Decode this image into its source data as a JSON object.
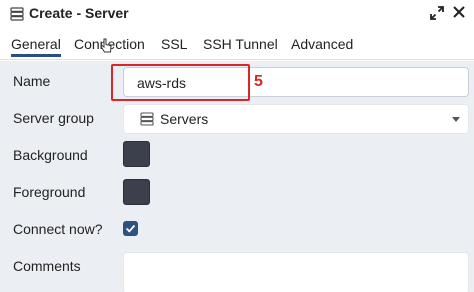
{
  "window": {
    "title": "Create - Server",
    "title_icon": "server-icon",
    "expand_icon": "expand-icon",
    "close_icon": "close-icon",
    "close_glyph": "✕"
  },
  "tabs": [
    {
      "label": "General",
      "active": true
    },
    {
      "label": "Connection",
      "active": false
    },
    {
      "label": "SSL",
      "active": false
    },
    {
      "label": "SSH Tunnel",
      "active": false
    },
    {
      "label": "Advanced",
      "active": false
    }
  ],
  "form": {
    "name": {
      "label": "Name",
      "value": "aws-rds"
    },
    "server_group": {
      "label": "Server group",
      "value": "Servers",
      "icon": "server-group-icon"
    },
    "background": {
      "label": "Background",
      "color": "#3c3f4c"
    },
    "foreground": {
      "label": "Foreground",
      "color": "#3c3f4c"
    },
    "connect_now": {
      "label": "Connect now?",
      "checked": true
    },
    "comments": {
      "label": "Comments",
      "value": ""
    }
  },
  "annotation": {
    "step_number": "5",
    "color": "#d9262b"
  },
  "colors": {
    "accent": "#2c4e86",
    "form_background": "#ebeef3"
  }
}
